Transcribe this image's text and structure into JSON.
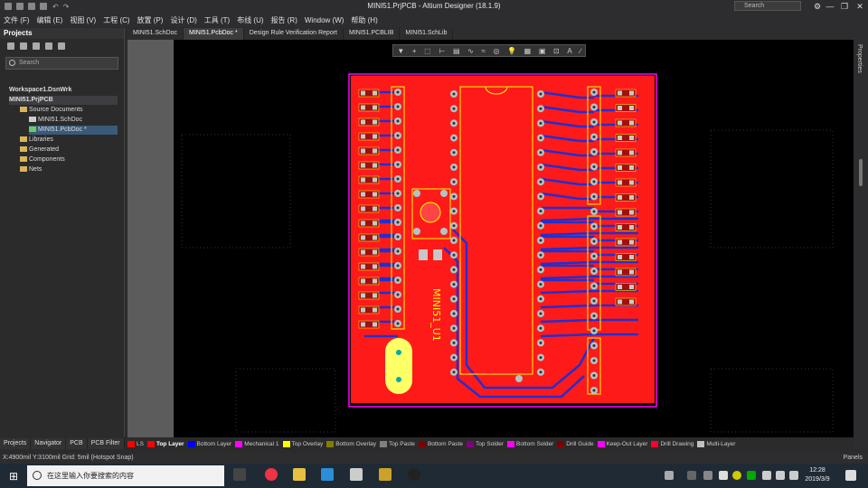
{
  "window": {
    "title": "MINI51.PrjPCB - Altium Designer (18.1.9)",
    "search_placeholder": "Search",
    "min": "—",
    "max": "❐",
    "close": "✕"
  },
  "menu": [
    "文件 (F)",
    "编辑 (E)",
    "视图 (V)",
    "工程 (C)",
    "放置 (P)",
    "设计 (D)",
    "工具 (T)",
    "布线 (U)",
    "报告 (R)",
    "Window (W)",
    "帮助 (H)"
  ],
  "projects": {
    "title": "Projects",
    "search": "Search",
    "tree": [
      "Workspace1.DsnWrk",
      "MINI51.PrjPCB",
      "Source Documents",
      "MINI51.SchDoc",
      "MINI51.PcbDoc *",
      "Libraries",
      "Generated",
      "Components",
      "Nets"
    ]
  },
  "bottom_tabs": [
    "Projects",
    "Navigator",
    "PCB",
    "PCB Filter"
  ],
  "doc_tabs": [
    "MINI51.SchDoc",
    "MINI51.PcbDoc *",
    "Design Rule Verification Report",
    "MINI51.PCBLIB",
    "MINI51.SchLib"
  ],
  "pcb": {
    "silk_label": "MINI51_U1"
  },
  "layers": [
    {
      "name": "LS",
      "color": "#ff0000"
    },
    {
      "name": "Top Layer",
      "color": "#ff0000"
    },
    {
      "name": "Bottom Layer",
      "color": "#0000ff"
    },
    {
      "name": "Mechanical 1",
      "color": "#ff00ff"
    },
    {
      "name": "Top Overlay",
      "color": "#ffff00"
    },
    {
      "name": "Bottom Overlay",
      "color": "#808000"
    },
    {
      "name": "Top Paste",
      "color": "#808080"
    },
    {
      "name": "Bottom Paste",
      "color": "#800000"
    },
    {
      "name": "Top Solder",
      "color": "#800080"
    },
    {
      "name": "Bottom Solder",
      "color": "#ff00ff"
    },
    {
      "name": "Drill Guide",
      "color": "#800000"
    },
    {
      "name": "Keep-Out Layer",
      "color": "#ff00ff"
    },
    {
      "name": "Drill Drawing",
      "color": "#ff002a"
    },
    {
      "name": "Multi-Layer",
      "color": "#c0c0c0"
    }
  ],
  "status": {
    "text": "X:4900mil Y:3100mil    Grid: 5mil       (Hotspot Snap)",
    "panels": "Panels",
    "right_panel": "Properties"
  },
  "taskbar": {
    "search": "在这里输入你要搜索的内容",
    "time": "12:28",
    "date": "2019/3/9"
  }
}
